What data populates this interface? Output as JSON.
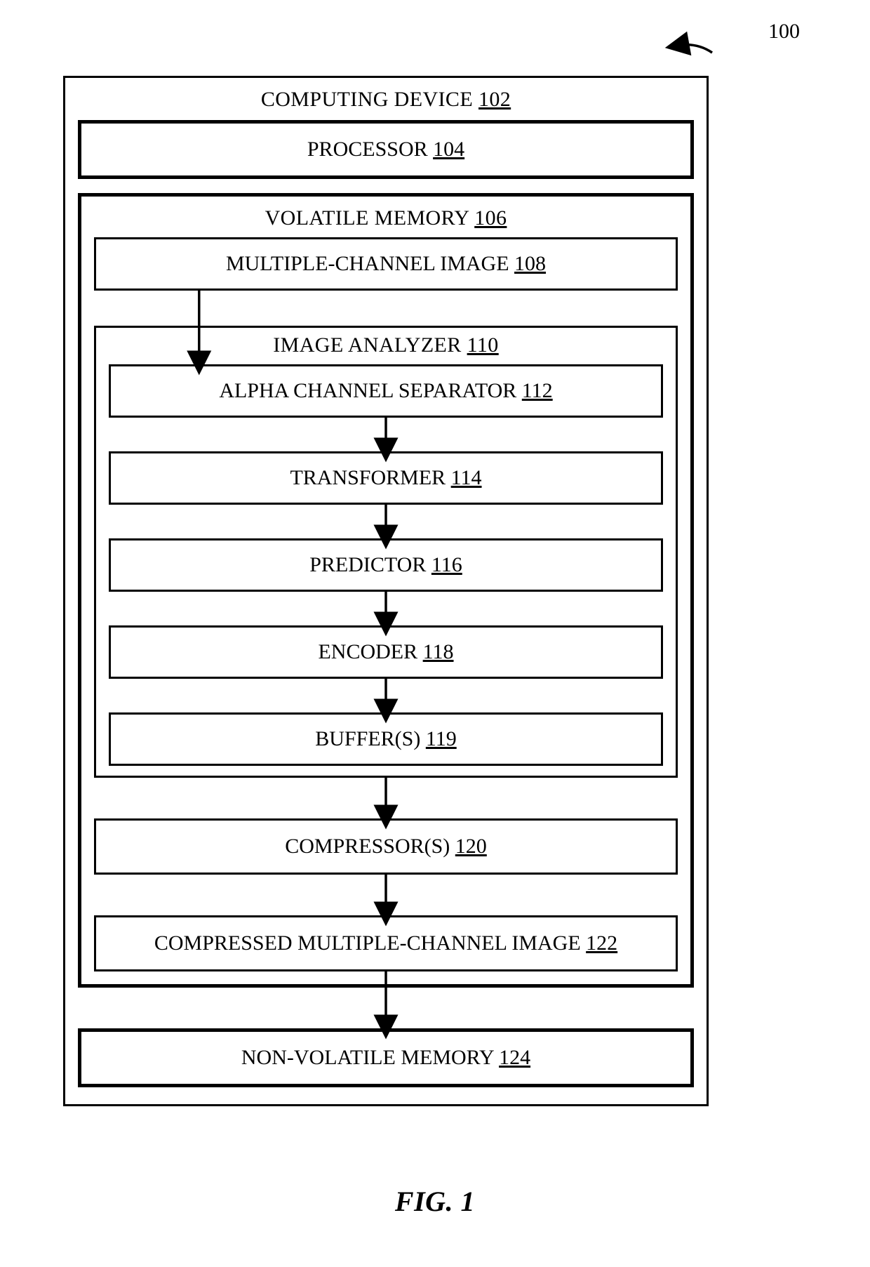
{
  "figure": {
    "caption": "FIG. 1",
    "ref_label": "100"
  },
  "device": {
    "label": "COMPUTING DEVICE",
    "ref": "102"
  },
  "processor": {
    "label": "PROCESSOR",
    "ref": "104"
  },
  "vmem": {
    "label": "VOLATILE MEMORY",
    "ref": "106"
  },
  "mci": {
    "label": "MULTIPLE-CHANNEL IMAGE",
    "ref": "108"
  },
  "analyzer": {
    "label": "IMAGE ANALYZER",
    "ref": "110"
  },
  "steps": [
    {
      "label": "ALPHA CHANNEL SEPARATOR",
      "ref": "112"
    },
    {
      "label": "TRANSFORMER",
      "ref": "114"
    },
    {
      "label": "PREDICTOR",
      "ref": "116"
    },
    {
      "label": "ENCODER",
      "ref": "118"
    },
    {
      "label": "BUFFER(S)",
      "ref": "119"
    }
  ],
  "compressors": {
    "label": "COMPRESSOR(S)",
    "ref": "120"
  },
  "cmci": {
    "label": "COMPRESSED MULTIPLE-CHANNEL IMAGE",
    "ref": "122"
  },
  "nvmem": {
    "label": "NON-VOLATILE MEMORY",
    "ref": "124"
  }
}
